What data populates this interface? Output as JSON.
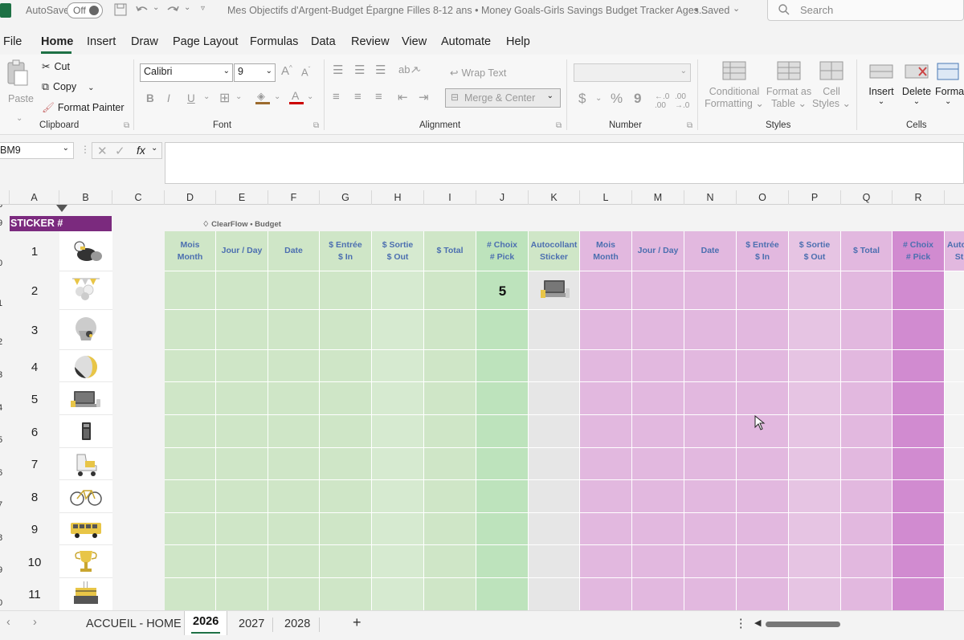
{
  "titlebar": {
    "autosave_label": "AutoSave",
    "autosave_state": "Off",
    "doc_title": "Mes Objectifs d'Argent-Budget Épargne Filles 8-12 ans • Money Goals-Girls Savings Budget Tracker Ages...",
    "save_status": "• Saved",
    "search_placeholder": "Search"
  },
  "menu": [
    "File",
    "Home",
    "Insert",
    "Draw",
    "Page Layout",
    "Formulas",
    "Data",
    "Review",
    "View",
    "Automate",
    "Help"
  ],
  "ribbon": {
    "clipboard": {
      "paste": "Paste",
      "cut": "Cut",
      "copy": "Copy",
      "format_painter": "Format Painter",
      "label": "Clipboard"
    },
    "font": {
      "name": "Calibri",
      "size": "9",
      "label": "Font",
      "bold": "B",
      "italic": "I",
      "underline": "U"
    },
    "alignment": {
      "wrap": "Wrap Text",
      "merge": "Merge & Center",
      "label": "Alignment"
    },
    "number": {
      "label": "Number",
      "currency": "$",
      "percent": "%",
      "comma": "9"
    },
    "styles": {
      "conditional": "Conditional",
      "conditional2": "Formatting",
      "format_as": "Format as",
      "format_as2": "Table",
      "cell": "Cell",
      "cell2": "Styles",
      "label": "Styles"
    },
    "cells": {
      "insert": "Insert",
      "delete": "Delete",
      "format": "Forma",
      "label": "Cells"
    }
  },
  "formula_bar": {
    "name_box": "BM9",
    "fx": "fx",
    "value": ""
  },
  "columns": [
    "A",
    "B",
    "C",
    "D",
    "E",
    "F",
    "G",
    "H",
    "I",
    "J",
    "K",
    "L",
    "M",
    "N",
    "O",
    "P",
    "Q",
    "R"
  ],
  "row_numbers_partial": [
    "8",
    "9",
    "0",
    "1",
    "2",
    "3",
    "4",
    "5",
    "6",
    "7",
    "8",
    "9",
    "0"
  ],
  "sheet": {
    "sticker_header": "STICKER #",
    "brand": "ClearFlow • Budget",
    "green_headers": [
      [
        "Mois",
        "Month"
      ],
      [
        "Jour / Day"
      ],
      [
        "Date"
      ],
      [
        "$ Entrée",
        "$ In"
      ],
      [
        "$ Sortie",
        "$ Out"
      ],
      [
        "$ Total"
      ],
      [
        "# Choix",
        "# Pick"
      ],
      [
        "Autocollant",
        "Sticker"
      ]
    ],
    "pink_headers": [
      [
        "Mois",
        "Month"
      ],
      [
        "Jour / Day"
      ],
      [
        "Date"
      ],
      [
        "$ Entrée",
        "$ In"
      ],
      [
        "$ Sortie",
        "$ Out"
      ],
      [
        "$ Total"
      ],
      [
        "# Choix",
        "# Pick"
      ],
      [
        "Auto",
        "St"
      ]
    ],
    "sticker_numbers": [
      "1",
      "2",
      "3",
      "4",
      "5",
      "6",
      "7",
      "8",
      "9",
      "10",
      "11"
    ],
    "sticker_icons": [
      "dog-sticker-icon",
      "party-balloons-icon",
      "cupcake-icon",
      "ball-icon",
      "laptop-icon",
      "calculator-icon",
      "roller-skate-icon",
      "bicycle-icon",
      "school-bus-icon",
      "trophy-icon",
      "birthday-cake-icon"
    ],
    "pick_value": "5"
  },
  "sheet_tabs": [
    "ACCUEIL - HOME",
    "2026",
    "2027",
    "2028"
  ],
  "active_tab": "2026",
  "colors": {
    "green": "#cfe6c7",
    "green_pick": "#bde3bc",
    "gray": "#e6e6e6",
    "pink": "#e2b8df",
    "pink_pick": "#d18bd0",
    "purple": "#7b2a7e"
  }
}
